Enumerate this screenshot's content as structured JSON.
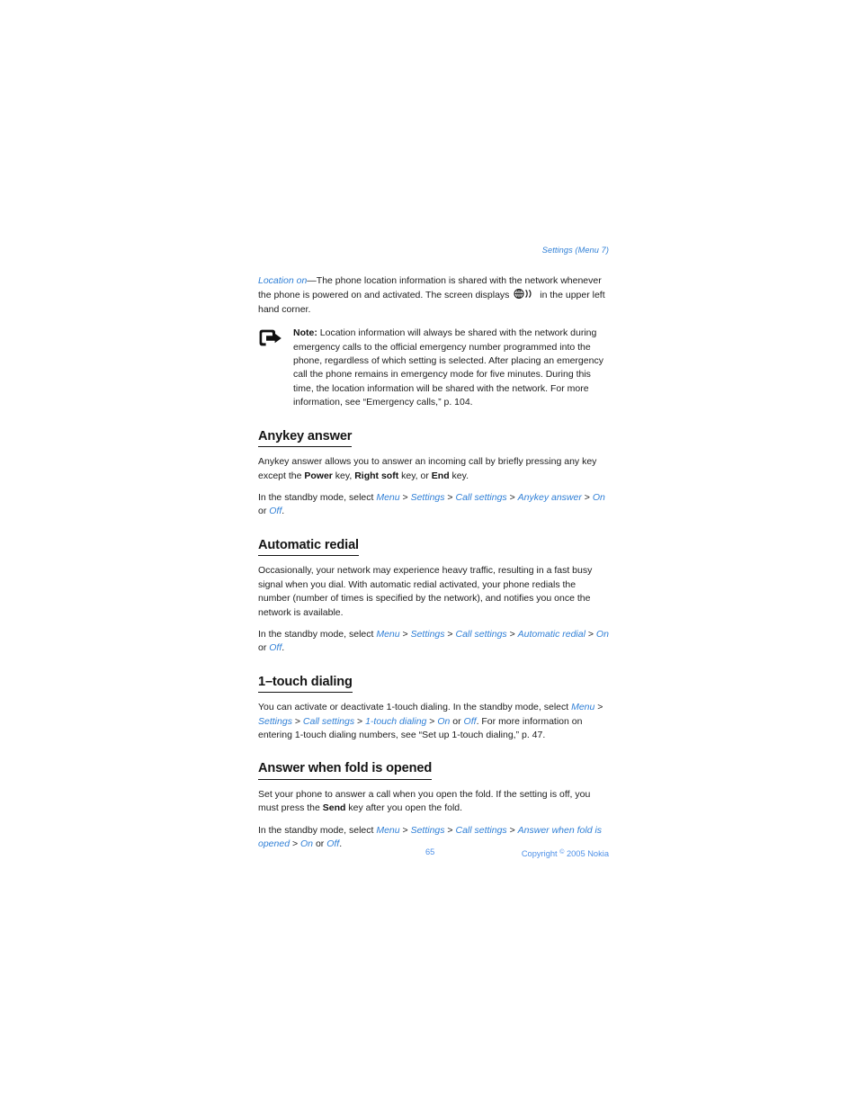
{
  "header": {
    "running_head": "Settings (Menu 7)"
  },
  "intro": {
    "term": "Location on",
    "dash": "—",
    "text_before_glyph": "The phone location information is shared with the network whenever the phone is powered on and activated. The screen displays ",
    "glyph_name": "location-signal-icon",
    "text_after_glyph": " in the upper left hand corner."
  },
  "note": {
    "icon_name": "note-arrow-icon",
    "label": "Note:",
    "text": " Location information will always be shared with the network during emergency calls to the official emergency number programmed into the phone, regardless of which setting is selected. After placing an emergency call the phone remains in emergency mode for five minutes. During this time, the location information will be shared with the network. For more information, see “Emergency calls,” p. 104."
  },
  "sections": [
    {
      "id": "anykey-answer",
      "heading": "Anykey answer",
      "body_parts": [
        {
          "t": "Anykey answer allows you to answer an incoming call by briefly pressing any key except the "
        },
        {
          "t": "Power",
          "b": true
        },
        {
          "t": " key, "
        },
        {
          "t": "Right soft",
          "b": true
        },
        {
          "t": " key, or "
        },
        {
          "t": "End",
          "b": true
        },
        {
          "t": " key."
        }
      ],
      "path_parts": [
        {
          "t": "In the standby mode, select "
        },
        {
          "t": "Menu",
          "i": true
        },
        {
          "t": " > "
        },
        {
          "t": "Settings",
          "i": true
        },
        {
          "t": " > "
        },
        {
          "t": "Call settings",
          "i": true
        },
        {
          "t": " > "
        },
        {
          "t": "Anykey answer",
          "i": true
        },
        {
          "t": " > "
        },
        {
          "t": "On",
          "i": true
        },
        {
          "t": " or "
        },
        {
          "t": "Off",
          "i": true
        },
        {
          "t": "."
        }
      ]
    },
    {
      "id": "automatic-redial",
      "heading": "Automatic redial",
      "body_parts": [
        {
          "t": "Occasionally, your network may experience heavy traffic, resulting in a fast busy signal when you dial. With automatic redial activated, your phone redials the number (number of times is specified by the network), and notifies you once the network is available."
        }
      ],
      "path_parts": [
        {
          "t": "In the standby mode, select "
        },
        {
          "t": "Menu",
          "i": true
        },
        {
          "t": " > "
        },
        {
          "t": "Settings",
          "i": true
        },
        {
          "t": " > "
        },
        {
          "t": "Call settings",
          "i": true
        },
        {
          "t": " > "
        },
        {
          "t": "Automatic redial",
          "i": true
        },
        {
          "t": " > "
        },
        {
          "t": "On",
          "i": true
        },
        {
          "t": " or "
        },
        {
          "t": "Off",
          "i": true
        },
        {
          "t": "."
        }
      ]
    },
    {
      "id": "one-touch-dialing",
      "heading": "1–touch dialing",
      "body_parts": [
        {
          "t": "You can activate or deactivate 1-touch dialing. In the standby mode, select "
        },
        {
          "t": "Menu",
          "i": true
        },
        {
          "t": " > "
        },
        {
          "t": "Settings",
          "i": true
        },
        {
          "t": " > "
        },
        {
          "t": "Call settings",
          "i": true
        },
        {
          "t": " > "
        },
        {
          "t": "1-touch dialing",
          "i": true
        },
        {
          "t": " > "
        },
        {
          "t": "On",
          "i": true
        },
        {
          "t": " or "
        },
        {
          "t": "Off",
          "i": true
        },
        {
          "t": ". For more information on entering 1-touch dialing numbers, see “Set up 1-touch dialing,” p. 47."
        }
      ],
      "path_parts": []
    },
    {
      "id": "answer-when-fold-is-opened",
      "heading": "Answer when fold is opened",
      "body_parts": [
        {
          "t": "Set your phone to answer a call when you open the fold. If the setting is off, you must press the "
        },
        {
          "t": "Send",
          "b": true
        },
        {
          "t": " key after you open the fold."
        }
      ],
      "path_parts": [
        {
          "t": "In the standby mode, select "
        },
        {
          "t": "Menu",
          "i": true
        },
        {
          "t": " > "
        },
        {
          "t": "Settings",
          "i": true
        },
        {
          "t": " > "
        },
        {
          "t": "Call settings",
          "i": true
        },
        {
          "t": " > "
        },
        {
          "t": "Answer when fold is opened",
          "i": true
        },
        {
          "t": " > "
        },
        {
          "t": "On",
          "i": true
        },
        {
          "t": " or "
        },
        {
          "t": "Off",
          "i": true
        },
        {
          "t": "."
        }
      ]
    }
  ],
  "footer": {
    "page_number": "65",
    "copyright_prefix": "Copyright ",
    "copyright_symbol": "©",
    "copyright_suffix": " 2005 Nokia"
  },
  "colors": {
    "link_blue": "#2f7fd6",
    "footer_blue": "#4d90e8",
    "body_text": "#1c1c1c"
  }
}
